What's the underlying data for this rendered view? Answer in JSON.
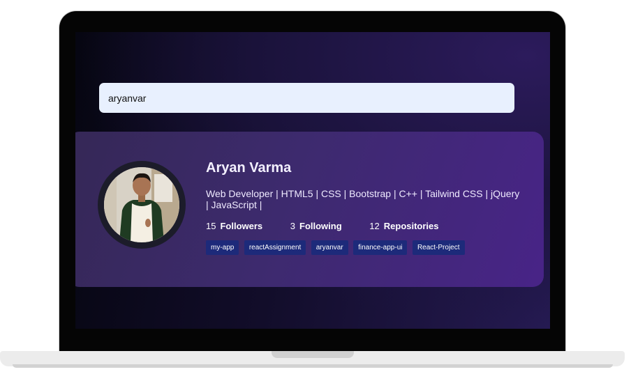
{
  "search": {
    "value": "aryanvar"
  },
  "profile": {
    "name": "Aryan Varma",
    "bio": "Web Developer | HTML5 | CSS | Bootstrap | C++ | Tailwind CSS | jQuery | JavaScript |",
    "stats": [
      {
        "count": "15",
        "label": "Followers"
      },
      {
        "count": "3",
        "label": "Following"
      },
      {
        "count": "12",
        "label": "Repositories"
      }
    ],
    "repos": [
      "my-app",
      "reactAssignment",
      "aryanvar",
      "finance-app-ui",
      "React-Project"
    ]
  },
  "colors": {
    "accent": "#482487",
    "repo_tag": "#1d2a7a",
    "input_bg": "#e8f0fe"
  }
}
